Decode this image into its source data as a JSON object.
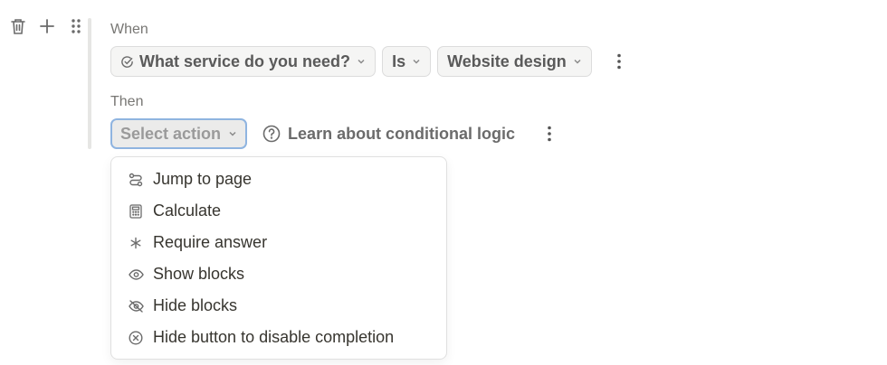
{
  "toolbar": {
    "icons": [
      "trash-icon",
      "plus-icon",
      "drag-handle-icon"
    ]
  },
  "condition": {
    "when_label": "When",
    "field": "What service do you need?",
    "operator": "Is",
    "value": "Website design"
  },
  "action": {
    "then_label": "Then",
    "select_placeholder": "Select action",
    "learn_link": "Learn about conditional logic"
  },
  "menu": {
    "items": [
      {
        "label": "Jump to page",
        "icon": "jump-icon"
      },
      {
        "label": "Calculate",
        "icon": "calculator-icon"
      },
      {
        "label": "Require answer",
        "icon": "asterisk-icon"
      },
      {
        "label": "Show blocks",
        "icon": "eye-icon"
      },
      {
        "label": "Hide blocks",
        "icon": "eye-off-icon"
      },
      {
        "label": "Hide button to disable completion",
        "icon": "circle-x-icon"
      }
    ]
  }
}
